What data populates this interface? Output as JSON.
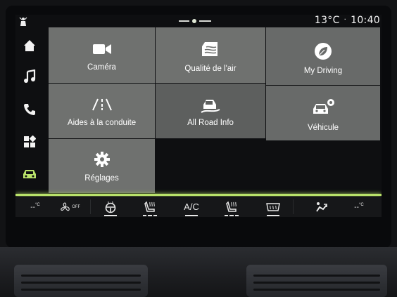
{
  "status": {
    "temperature": "13°C",
    "separator": "·",
    "time": "10:40"
  },
  "sidebar": {
    "top_icon": "seat-person-icon",
    "items": [
      {
        "icon": "home-icon"
      },
      {
        "icon": "music-note-icon"
      },
      {
        "icon": "phone-icon"
      },
      {
        "icon": "apps-grid-icon"
      },
      {
        "icon": "car-icon",
        "active": true
      }
    ]
  },
  "tiles": [
    {
      "label": "Caméra",
      "icon": "camera-icon"
    },
    {
      "label": "Qualité de l'air",
      "icon": "air-quality-icon"
    },
    {
      "label": "My Driving",
      "icon": "leaf-icon"
    },
    {
      "label": "Aides à la conduite",
      "icon": "lane-assist-icon"
    },
    {
      "label": "All Road Info",
      "icon": "all-road-info-icon"
    },
    {
      "label": "Véhicule",
      "icon": "vehicle-settings-icon"
    },
    {
      "label": "Réglages",
      "icon": "gear-icon"
    }
  ],
  "climate": {
    "left_temp": "--",
    "left_temp_unit": "°C",
    "fan_state": "OFF",
    "ac_label": "A/C",
    "right_temp": "--",
    "right_temp_unit": "°C"
  },
  "colors": {
    "accent": "#b9e26a",
    "tile": "#6f716f",
    "background": "#0e0f11"
  }
}
